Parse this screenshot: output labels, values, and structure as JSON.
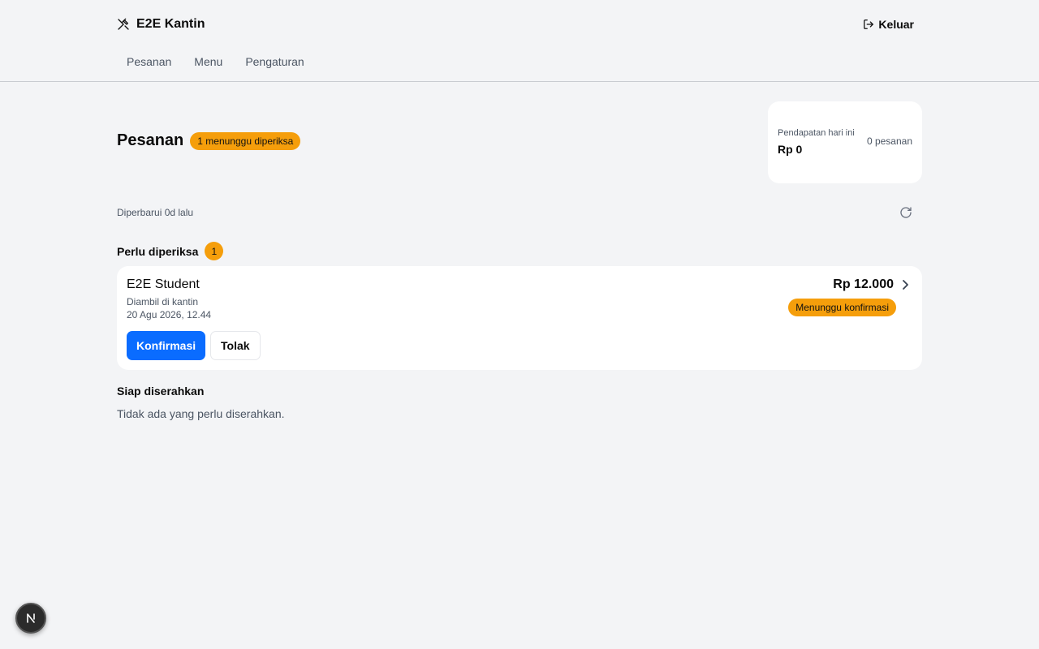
{
  "header": {
    "brand_title": "E2E Kantin",
    "brand_icon": "utensils-crossed-icon",
    "logout_label": "Keluar",
    "logout_icon": "log-out-icon"
  },
  "nav": {
    "items": [
      {
        "label": "Pesanan"
      },
      {
        "label": "Menu"
      },
      {
        "label": "Pengaturan"
      }
    ]
  },
  "page": {
    "title": "Pesanan",
    "pending_badge": "1 menunggu diperiksa",
    "updated_text": "Diperbarui 0d lalu",
    "refresh_icon": "refresh-icon"
  },
  "revenue": {
    "label": "Pendapatan hari ini",
    "value": "Rp 0",
    "orders_count": "0 pesanan"
  },
  "review_section": {
    "title": "Perlu diperiksa",
    "count": "1",
    "orders": [
      {
        "customer": "E2E Student",
        "pickup": "Diambil di kantin",
        "time": "20 Agu 2026, 12.44",
        "price": "Rp 12.000",
        "status": "Menunggu konfirmasi",
        "confirm_label": "Konfirmasi",
        "reject_label": "Tolak"
      }
    ]
  },
  "ready_section": {
    "title": "Siap diserahkan",
    "empty_text": "Tidak ada yang perlu diserahkan."
  },
  "dev_badge": {
    "icon": "nextjs-n-icon"
  },
  "colors": {
    "background": "#f3f4f6",
    "card": "#ffffff",
    "accent_orange": "#f59e0b",
    "primary_blue": "#0a6cff"
  }
}
